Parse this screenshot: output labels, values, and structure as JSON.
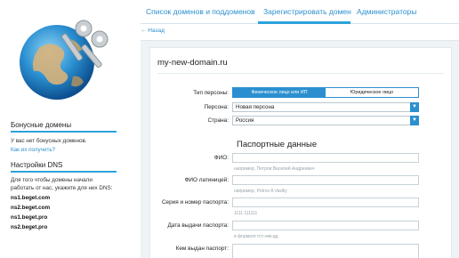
{
  "sidebar": {
    "bonus_title": "Бонусные домены",
    "bonus_empty": "У вас нет бонусных доменов.",
    "bonus_link": "Как их получить?",
    "dns_title": "Настройки DNS",
    "dns_text_line1": "Для того чтобы домены начали",
    "dns_text_line2": "работать от нас, укажите для них DNS:",
    "ns": [
      "ns1.beget.com",
      "ns2.beget.com",
      "ns1.beget.pro",
      "ns2.beget.pro"
    ]
  },
  "tabs": [
    {
      "label": "Список доменов и поддоменов"
    },
    {
      "label": "Зарегистрировать домен"
    },
    {
      "label": "Администраторы"
    }
  ],
  "active_tab": "Зарегистрировать домен",
  "back_label": "← Назад",
  "form": {
    "domain": "my-new-domain.ru",
    "person_type_label": "Тип персоны:",
    "person_type_options": [
      "Физическое лицо или ИП",
      "Юридическое лицо"
    ],
    "person_type_selected": "Физическое лицо или ИП",
    "persona_label": "Персона:",
    "persona_value": "Новая персона",
    "country_label": "Страна:",
    "country_value": "Россия",
    "passport_section": "Паспортные данные",
    "fio_label": "ФИО:",
    "fio_hint": "например, Петров Василий Андреевич",
    "fio_latin_label": "ФИО латиницей:",
    "fio_latin_hint": "например, Petrov A Vasiliy",
    "passport_number_label": "Серия и номер паспорта:",
    "passport_number_hint": "1111 111111",
    "issue_date_label": "Дата выдачи паспорта:",
    "issue_date_hint": "в формате гггг-мм-дд",
    "issued_by_label": "Кем выдан паспорт:"
  },
  "colors": {
    "accent": "#2b8fcf",
    "tab_underline": "#2ba3db",
    "panel_bg": "#eef3f6"
  }
}
